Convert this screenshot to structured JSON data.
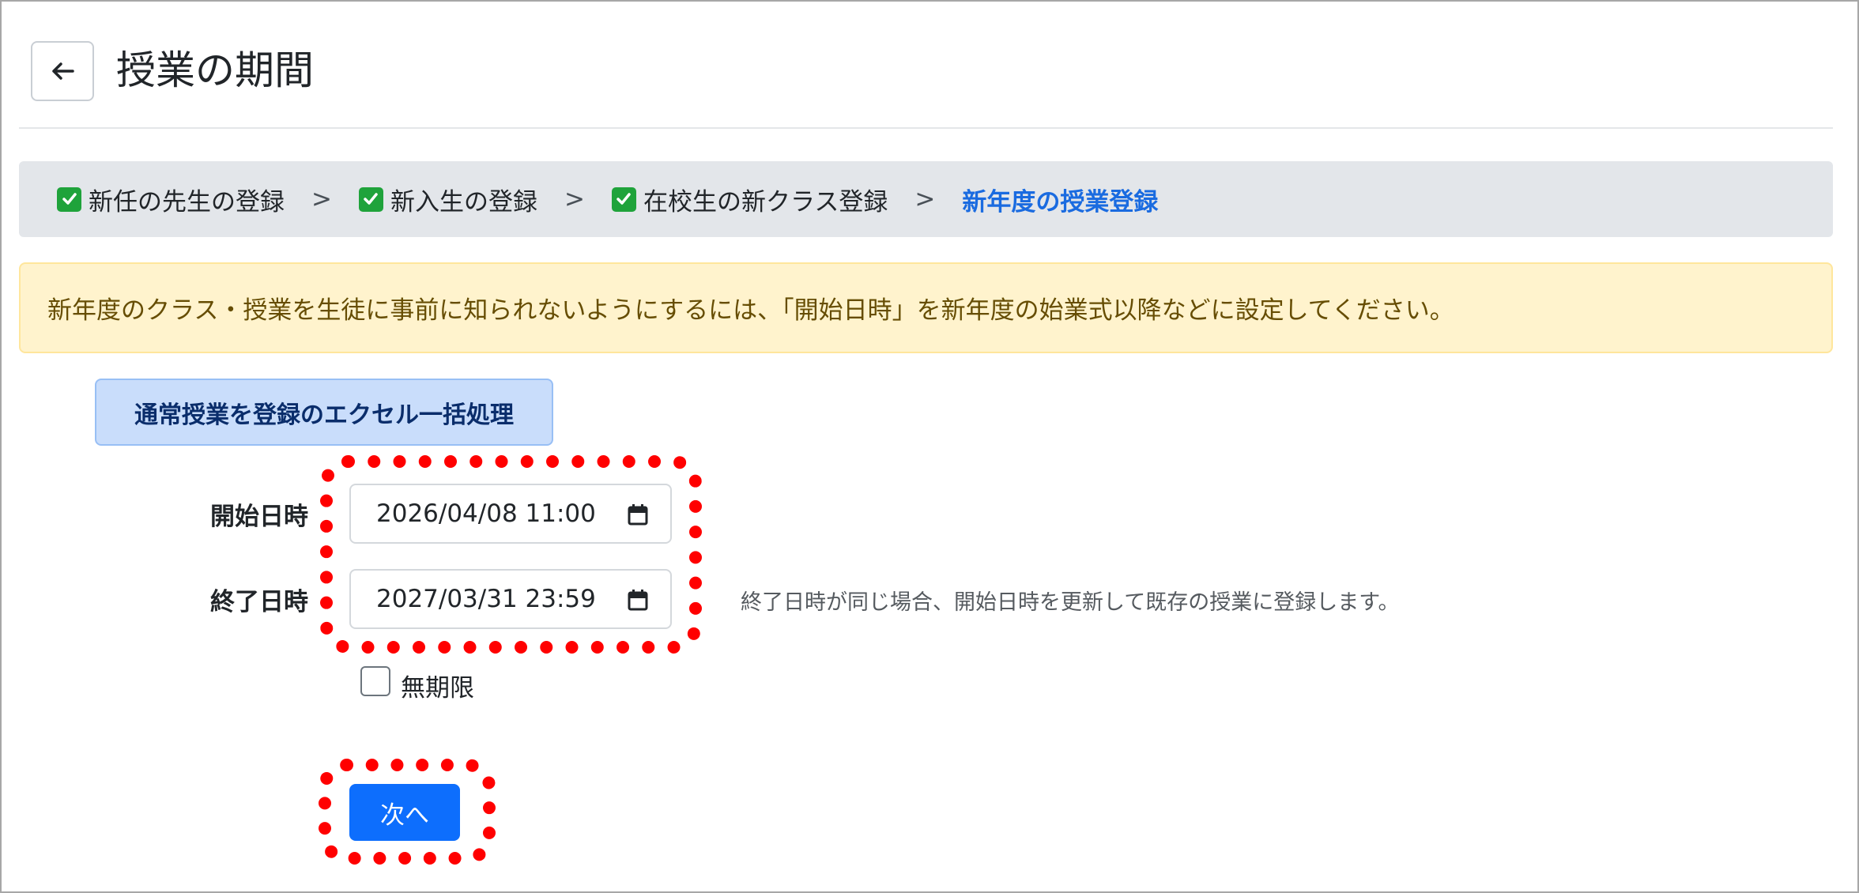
{
  "header": {
    "back_icon": "arrow-left-icon",
    "title": "授業の期間"
  },
  "breadcrumb": {
    "steps": [
      {
        "label": "新任の先生の登録",
        "done": true
      },
      {
        "label": "新入生の登録",
        "done": true
      },
      {
        "label": "在校生の新クラス登録",
        "done": true
      },
      {
        "label": "新年度の授業登録",
        "done": false,
        "active": true
      }
    ],
    "separator": ">"
  },
  "alert": {
    "text": "新年度のクラス・授業を生徒に事前に知られないようにするには、「開始日時」を新年度の始業式以降などに設定してください。"
  },
  "excel_button": {
    "label": "通常授業を登録のエクセル一括処理"
  },
  "form": {
    "start_label": "開始日時",
    "start_value": "2026/04/08 11:00",
    "end_label": "終了日時",
    "end_value": "2027/03/31 23:59",
    "help_text": "終了日時が同じ場合、開始日時を更新して既存の授業に登録します。",
    "no_limit_label": "無期限",
    "no_limit_checked": false,
    "next_label": "次へ"
  },
  "colors": {
    "primary": "#0d6efd",
    "active_crumb": "#1a6be0",
    "check": "#1fa33b",
    "alert_bg": "#fff3cd",
    "highlight": "#ff0000"
  }
}
